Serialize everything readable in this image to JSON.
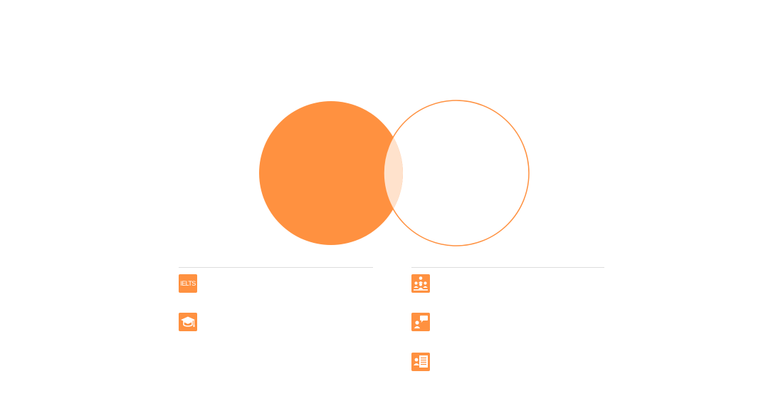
{
  "colors": {
    "accent": "#FF9140",
    "overlap": "#FFE2CC",
    "divider": "#DDDDDD",
    "background": "#FFFFFF"
  },
  "venn": {
    "left_circle": {
      "style": "filled"
    },
    "right_circle": {
      "style": "outline"
    }
  },
  "left_column": {
    "items": [
      {
        "icon": "ielts-icon",
        "text": "IELTS"
      },
      {
        "icon": "graduation-cap-icon"
      }
    ]
  },
  "right_column": {
    "items": [
      {
        "icon": "group-class-icon"
      },
      {
        "icon": "speaking-person-icon"
      },
      {
        "icon": "profile-card-icon"
      }
    ]
  }
}
